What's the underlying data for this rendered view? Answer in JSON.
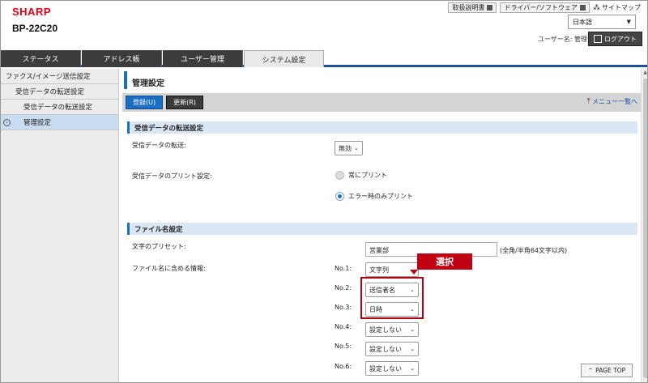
{
  "header": {
    "brand": "SHARP",
    "model": "BP-22C20",
    "links": [
      "取扱説明書",
      "ドライバー/ソフトウェア"
    ],
    "sitemap": "サイトマップ",
    "language": "日本語",
    "user_label": "ユーザー名: 管理者",
    "logout": "ログアウト"
  },
  "tabs": [
    "ステータス",
    "アドレス帳",
    "ユーザー管理",
    "システム設定"
  ],
  "sidebar": {
    "items": [
      "ファクス/イメージ送信設定",
      "受信データの転送設定",
      "受信データの転送設定",
      "管理設定"
    ]
  },
  "main": {
    "title": "管理設定",
    "register_button": "登録(U)",
    "update_button": "更新(R)",
    "menu_list_link": "メニュー一覧へ",
    "section1": {
      "title": "受信データの転送設定",
      "transfer_label": "受信データの転送:",
      "transfer_value": "無効",
      "print_label": "受信データのプリント設定:",
      "print_options": [
        "常にプリント",
        "エラー時のみプリント"
      ],
      "print_selected": "エラー時のみプリント"
    },
    "section2": {
      "title": "ファイル名設定",
      "preset_label": "文字のプリセット:",
      "preset_value": "営業部",
      "preset_note": "(全角/半角64文字以内)",
      "include_label": "ファイル名に含める情報:",
      "slots": [
        {
          "no": "No.1:",
          "value": "文字列"
        },
        {
          "no": "No.2:",
          "value": "送信者名"
        },
        {
          "no": "No.3:",
          "value": "日時"
        },
        {
          "no": "No.4:",
          "value": "設定しない"
        },
        {
          "no": "No.5:",
          "value": "設定しない"
        },
        {
          "no": "No.6:",
          "value": "設定しない"
        }
      ]
    },
    "callout": "選択",
    "page_top": "PAGE TOP"
  },
  "colors": {
    "brand": "#e60012",
    "accent": "#1a6fc0",
    "callout": "#c00012"
  }
}
